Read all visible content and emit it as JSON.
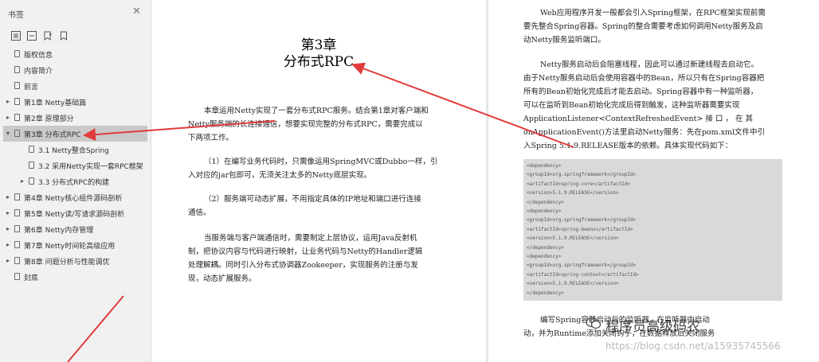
{
  "sidebar": {
    "title": "书签",
    "close_icon": "close-icon",
    "tools": [
      "expand-all-icon",
      "collapse-all-icon",
      "bookmark-add-icon",
      "bookmark-icon"
    ],
    "items": [
      {
        "label": "版权信息",
        "level": 0,
        "expandable": false
      },
      {
        "label": "内容简介",
        "level": 0,
        "expandable": false
      },
      {
        "label": "前言",
        "level": 0,
        "expandable": false
      },
      {
        "label": "第1章 Netty基础篇",
        "level": 0,
        "expandable": true,
        "expanded": false
      },
      {
        "label": "第2章 原理部分",
        "level": 0,
        "expandable": true,
        "expanded": false
      },
      {
        "label": "第3章 分布式RPC",
        "level": 0,
        "expandable": true,
        "expanded": true,
        "active": true
      },
      {
        "label": "3.1 Netty整合Spring",
        "level": 1,
        "expandable": false
      },
      {
        "label": "3.2 采用Netty实现一套RPC框架",
        "level": 1,
        "expandable": false
      },
      {
        "label": "3.3 分布式RPC的构建",
        "level": 1,
        "expandable": true,
        "expanded": false
      },
      {
        "label": "第4章 Netty核心组件源码剖析",
        "level": 0,
        "expandable": true,
        "expanded": false
      },
      {
        "label": "第5章 Netty读/写请求源码剖析",
        "level": 0,
        "expandable": true,
        "expanded": false
      },
      {
        "label": "第6章 Netty内存管理",
        "level": 0,
        "expandable": true,
        "expanded": false
      },
      {
        "label": "第7章 Netty时间轮高级应用",
        "level": 0,
        "expandable": true,
        "expanded": false
      },
      {
        "label": "第8章 问题分析与性能调优",
        "level": 0,
        "expandable": true,
        "expanded": false
      },
      {
        "label": "封底",
        "level": 0,
        "expandable": false
      }
    ]
  },
  "left_page": {
    "chapter_number": "第3章",
    "chapter_title": "分布式RPC",
    "paragraphs": [
      [
        "本章运用Netty实现了一套分布式RPC服务。结合第1章对客户端和",
        "Netty服务端的长连接通信，想要实现完整的分布式RPC，需要完成以",
        "下两项工作。"
      ],
      [
        "（1）在编写业务代码时，只需像运用SpringMVC或Dubbo一样，引",
        "入对应的jar包即可，无须关注太多的Netty底层实现。"
      ],
      [
        "（2）服务端可动态扩展，不用指定具体的IP地址和端口进行连接",
        "通信。"
      ],
      [
        "当服务端与客户端通信时，需要制定上层协议，运用Java反射机",
        "制，把协议内容与代码进行映射，让业务代码与Netty的Handler逻辑",
        "处理解耦。同时引入分布式协调器Zookeeper，实现服务的注册与发",
        "现，动态扩展服务。"
      ]
    ]
  },
  "right_page": {
    "paragraphs": [
      [
        "Web应用程序开发一般都会引入Spring框架，在RPC框架实现前需",
        "要先整合Spring容器。Spring的整合需要考虑如何调用Netty服务及启",
        "动Netty服务监听端口。"
      ],
      [
        "Netty服务启动后会阻塞线程，因此可以通过新建线程去启动它。",
        "由于Netty服务启动后会使用容器中的Bean，所以只有在Spring容器把",
        "所有的Bean初始化完成后才能去启动。Spring容器中有一种监听器，",
        "可以在监听到Bean初始化完成后得到触发，这种监听器需要实现",
        "ApplicationListener<ContextRefreshedEvent>  接  口  ，  在  其",
        "onApplicationEvent()方法里启动Netty服务：先在pom.xml文件中引",
        "入Spring 5.1.9.RELEASE版本的依赖。具体实现代码如下："
      ]
    ],
    "code_lines": [
      "<dependency>",
      "    <groupId>org.springframework</groupId>",
      "    <artifactId>spring-core</artifactId>",
      "    <version>5.1.9.RELEASE</version>",
      "</dependency>",
      "<dependency>",
      "    <groupId>org.springframework</groupId>",
      "    <artifactId>spring-beans</artifactId>",
      "    <version>5.1.9.RELEASE</version>",
      "</dependency>",
      "<dependency>",
      "    <groupId>org.springframework</groupId>",
      "    <artifactId>spring-context</artifactId>",
      "    <version>5.1.9.RELEASE</version>",
      "</dependency>"
    ],
    "bottom_paragraph": [
      "编写Spring容器启动后的监听器，在监听器中启动",
      "动，并为Runtime添加关闭钩子，在数据释放后关闭服务"
    ]
  },
  "watermark": {
    "text": "程序员高级码农",
    "url": "https://blog.csdn.net/a15935745566"
  },
  "colors": {
    "sidebar_bg": "#f1f1f1",
    "active_item_bg": "#c9c9c9",
    "arrow": "#e23b3b",
    "code_bg": "#d9d9d9"
  }
}
